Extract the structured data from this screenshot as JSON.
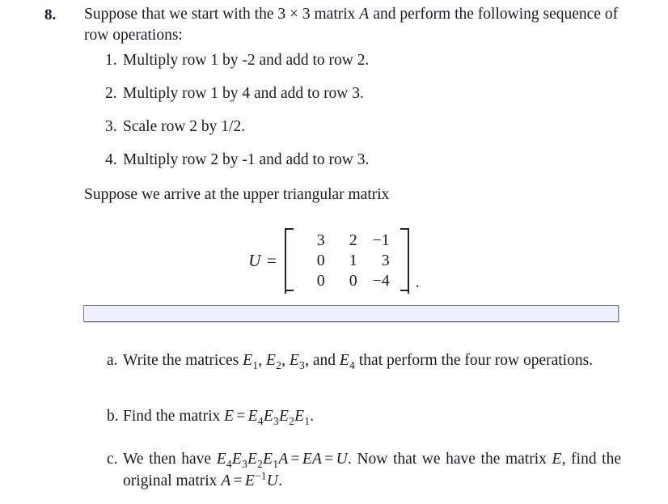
{
  "problem": {
    "number": "8.",
    "stem_part1": "Suppose that we start with the ",
    "stem_dimension": "3 × 3",
    "stem_part2": " matrix ",
    "stem_matrix_var": "A",
    "stem_part3": " and perform the following sequence of row operations:"
  },
  "operations": [
    {
      "marker": "1.",
      "text": "Multiply row 1 by -2 and add to row 2."
    },
    {
      "marker": "2.",
      "text": "Multiply row 1 by 4 and add to row 3."
    },
    {
      "marker": "3.",
      "text": "Scale row 2 by 1/2."
    },
    {
      "marker": "4.",
      "text": "Multiply row 2 by -1 and add to row 3."
    }
  ],
  "arrive_line": "Suppose we arrive at the upper triangular matrix",
  "matrix": {
    "label": "U",
    "equals": "=",
    "rows": [
      [
        "3",
        "2",
        "−1"
      ],
      [
        "0",
        "1",
        "3"
      ],
      [
        "0",
        "0",
        "−4"
      ]
    ],
    "trailing_punctuation": "."
  },
  "answer_input": {
    "value": "",
    "placeholder": ""
  },
  "sub_questions": [
    {
      "marker": "a.",
      "text_before": "Write the matrices ",
      "vars": [
        "E₁",
        "E₂",
        "E₃",
        "E₄"
      ],
      "var_base": "E",
      "var_subs": [
        "1",
        "2",
        "3",
        "4"
      ],
      "separator_1": ", ",
      "separator_2": ", ",
      "separator_3": ", and ",
      "text_after": " that perform the four row operations."
    },
    {
      "marker": "b.",
      "text_before": "Find the matrix ",
      "equation": "E = E₄E₃E₂E₁",
      "text_after": "."
    },
    {
      "marker": "c.",
      "text_before": "We then have ",
      "equation_1": "E₄E₃E₂E₁A = EA = U",
      "text_middle": ". Now that we have the matrix ",
      "var_E": "E",
      "text_middle_2": ", find the original matrix ",
      "equation_2": "A = E⁻¹U",
      "text_after": "."
    }
  ],
  "colors": {
    "text": "#1a1a24",
    "input_fill": "#eff0fb",
    "input_border": "#7f7f8c",
    "page_background": "#ffffff"
  }
}
